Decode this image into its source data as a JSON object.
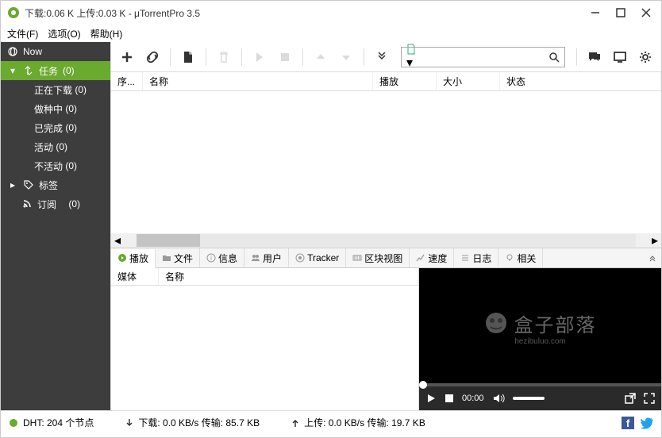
{
  "title": "下载:0.06 K 上传:0.03 K - μTorrentPro 3.5",
  "menus": {
    "file": "文件(F)",
    "options": "选项(O)",
    "help": "帮助(H)"
  },
  "sidebar": {
    "now": "Now",
    "tasks": {
      "label": "任务",
      "count": "(0)"
    },
    "downloading": {
      "label": "正在下载",
      "count": "(0)"
    },
    "seeding": {
      "label": "做种中",
      "count": "(0)"
    },
    "completed": {
      "label": "已完成",
      "count": "(0)"
    },
    "active": {
      "label": "活动",
      "count": "(0)"
    },
    "inactive": {
      "label": "不活动",
      "count": "(0)"
    },
    "labels": "标签",
    "feeds": {
      "label": "订阅",
      "count": "(0)"
    }
  },
  "columns": {
    "seq": "序...",
    "name": "名称",
    "play": "播放",
    "size": "大小",
    "status": "状态"
  },
  "tabs": {
    "play": "播放",
    "files": "文件",
    "info": "信息",
    "peers": "用户",
    "tracker": "Tracker",
    "pieces": "区块视图",
    "speed": "速度",
    "log": "日志",
    "related": "相关"
  },
  "mediaCols": {
    "media": "媒体",
    "name": "名称"
  },
  "watermark": {
    "text": "盒子部落",
    "url": "hezibuluo.com"
  },
  "player": {
    "time": "00:00"
  },
  "status": {
    "dht": "DHT: 204 个节点",
    "down": "下载: 0.0 KB/s 传输: 85.7 KB",
    "up": "上传: 0.0 KB/s 传输: 19.7 KB"
  }
}
